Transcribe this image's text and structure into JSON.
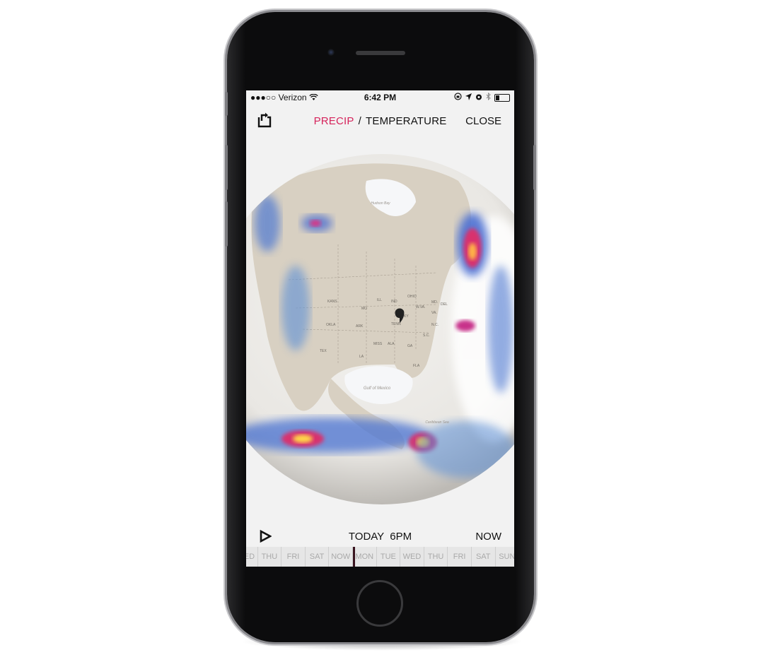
{
  "status_bar": {
    "carrier": "●●●○○ Verizon",
    "wifi_icon": "wifi-icon",
    "time": "6:42 PM",
    "icons": [
      "orientation-lock-icon",
      "location-icon",
      "alarm-icon",
      "bluetooth-icon",
      "battery-icon"
    ],
    "battery_level": 0.3
  },
  "nav": {
    "share_icon": "share-icon",
    "tab_precip": "PRECIP",
    "separator": "/",
    "tab_temperature": "TEMPERATURE",
    "active_tab": "PRECIP",
    "close_label": "CLOSE",
    "accent_color": "#d6245c"
  },
  "map": {
    "labels": {
      "hudson_bay": "Hudson Bay",
      "gulf": "Gulf of Mexico",
      "caribbean": "Caribbean Sea",
      "states": [
        "KANS",
        "MO",
        "ILL",
        "IND",
        "OHIO",
        "W.VA.",
        "VA.",
        "MD.",
        "DEL",
        "KY",
        "OKLA",
        "ARK",
        "TENN",
        "N.C.",
        "S.C.",
        "TEX",
        "MISS",
        "ALA",
        "GA",
        "LA",
        "FLA"
      ]
    },
    "pin_icon": "location-pin-icon"
  },
  "playback": {
    "play_icon": "play-icon",
    "current_time": "TODAY  6PM",
    "now_label": "NOW"
  },
  "timeline": {
    "days": [
      "WED",
      "THU",
      "FRI",
      "SAT",
      "NOW",
      "MON",
      "TUE",
      "WED",
      "THU",
      "FRI",
      "SAT",
      "SUN"
    ]
  }
}
